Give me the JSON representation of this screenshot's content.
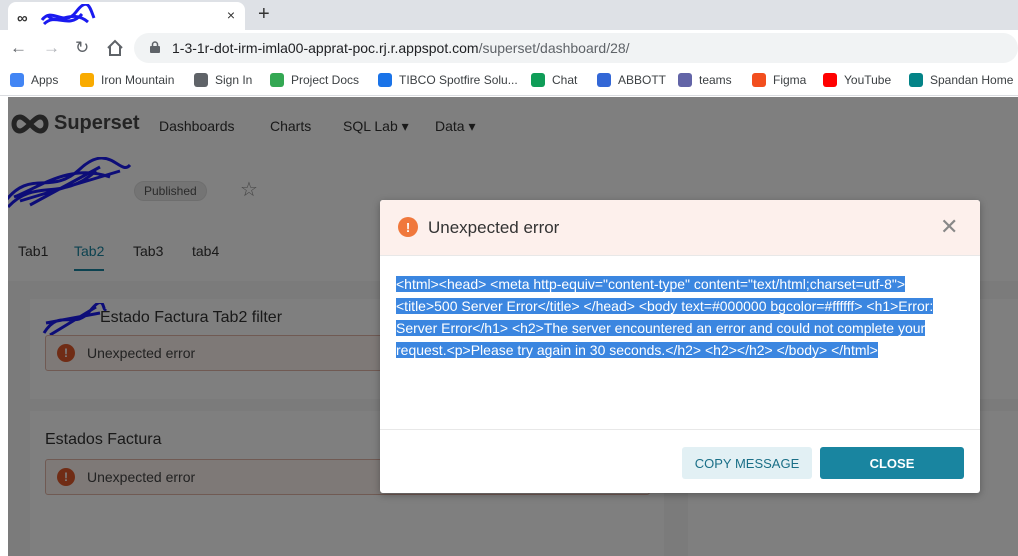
{
  "browser": {
    "tab": {
      "favicon": "∞",
      "close": "×"
    },
    "new_tab": "+",
    "url_host": "1-3-1r-dot-irm-imla00-apprat-poc.rj.r.appspot.com",
    "url_path": "/superset/dashboard/28/",
    "bookmarks": [
      {
        "label": "Apps",
        "icon": "apps-grid-icon",
        "color": "#4285f4"
      },
      {
        "label": "Iron Mountain",
        "icon": "bookmark-folder-icon",
        "color": "#f9ab00"
      },
      {
        "label": "Sign In",
        "icon": "globe-icon",
        "color": "#5f6368"
      },
      {
        "label": "Project Docs",
        "icon": "google-drive-icon",
        "color": "#34a853"
      },
      {
        "label": "TIBCO Spotfire Solu...",
        "icon": "spotfire-icon",
        "color": "#1a73e8"
      },
      {
        "label": "Chat",
        "icon": "chat-icon",
        "color": "#0f9d58"
      },
      {
        "label": "ABBOTT",
        "icon": "abbott-icon",
        "color": "#3367d6"
      },
      {
        "label": "teams",
        "icon": "teams-icon",
        "color": "#6264a7"
      },
      {
        "label": "Figma",
        "icon": "figma-icon",
        "color": "#f24e1e"
      },
      {
        "label": "YouTube",
        "icon": "youtube-icon",
        "color": "#ff0000"
      },
      {
        "label": "Spandan Home",
        "icon": "sharepoint-icon",
        "color": "#038387"
      }
    ]
  },
  "superset": {
    "logo": "Superset",
    "nav": [
      "Dashboards",
      "Charts",
      "SQL Lab ▾",
      "Data ▾"
    ],
    "status_pill": "Published",
    "tabs": [
      "Tab1",
      "Tab2",
      "Tab3",
      "tab4"
    ],
    "active_tab": "Tab2",
    "cards": [
      {
        "title": "Estado Factura Tab2 filter",
        "error": "Unexpected error"
      },
      {
        "title": "Estados Factura",
        "error": "Unexpected error"
      }
    ]
  },
  "modal": {
    "title": "Unexpected error",
    "message": "<html><head> <meta http-equiv=\"content-type\" content=\"text/html;charset=utf-8\"> <title>500 Server Error</title> </head> <body text=#000000 bgcolor=#ffffff> <h1>Error: Server Error</h1> <h2>The server encountered an error and could not complete your request.<p>Please try again in 30 seconds.</h2> <h2></h2> </body> </html>",
    "copy_label": "COPY MESSAGE",
    "close_label": "CLOSE"
  },
  "colors": {
    "accent": "#1985a0",
    "error": "#e0592a",
    "selection": "#3b86e0"
  }
}
